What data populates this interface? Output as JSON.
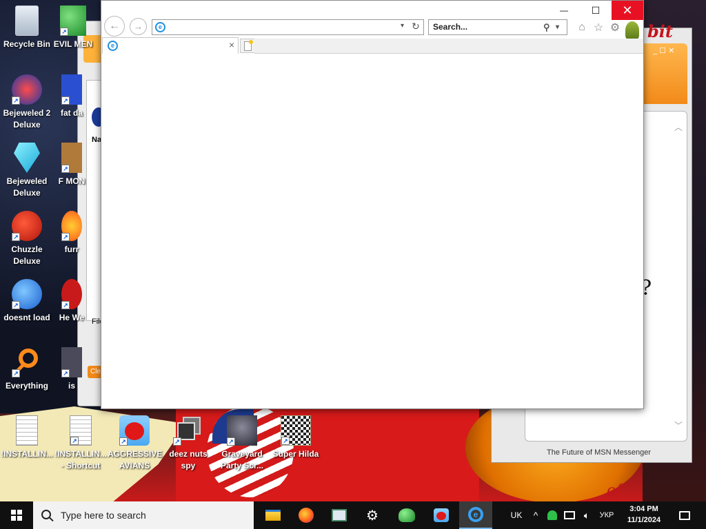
{
  "desktop": {
    "icons": [
      {
        "label": "Recycle Bin"
      },
      {
        "label": "EVIL MEN"
      },
      {
        "label": "Bejeweled 2 Deluxe"
      },
      {
        "label": "fat da"
      },
      {
        "label": "Bejeweled Deluxe"
      },
      {
        "label": "F MON"
      },
      {
        "label": "Chuzzle Deluxe"
      },
      {
        "label": "furr"
      },
      {
        "label": "doesnt load"
      },
      {
        "label": "He We"
      },
      {
        "label": "Everything"
      },
      {
        "label": "is"
      },
      {
        "label": "!INSTALLIN..."
      },
      {
        "label": "!INSTALLIN... - Shortcut"
      },
      {
        "label": "AGGRESSIVE AVIANS"
      },
      {
        "label": "deez nuts spy"
      },
      {
        "label": "Graveyard Party Scr..."
      },
      {
        "label": "Super Hilda"
      }
    ]
  },
  "background_windows": {
    "left_partial": {
      "label_na": "Na",
      "label_file": "File",
      "button": "Clea"
    },
    "msn": {
      "footer": "The Future of MSN Messenger",
      "big_text": "??",
      "logo_fragment": "bit",
      "wall_text": "of"
    }
  },
  "ie": {
    "search_placeholder": "Search...",
    "address_value": "",
    "tab_title": "",
    "window_buttons": {
      "minimize": "—",
      "maximize": "☐",
      "close": "✕"
    }
  },
  "taskbar": {
    "search_placeholder": "Type here to search",
    "language": "UK",
    "keyboard": "УКР",
    "time": "3:04 PM",
    "date": "11/1/2024"
  },
  "colors": {
    "close_red": "#e81123",
    "taskbar": "#101010",
    "ie_blue": "#1c8fe0",
    "msn_orange": "#f28a1a"
  }
}
